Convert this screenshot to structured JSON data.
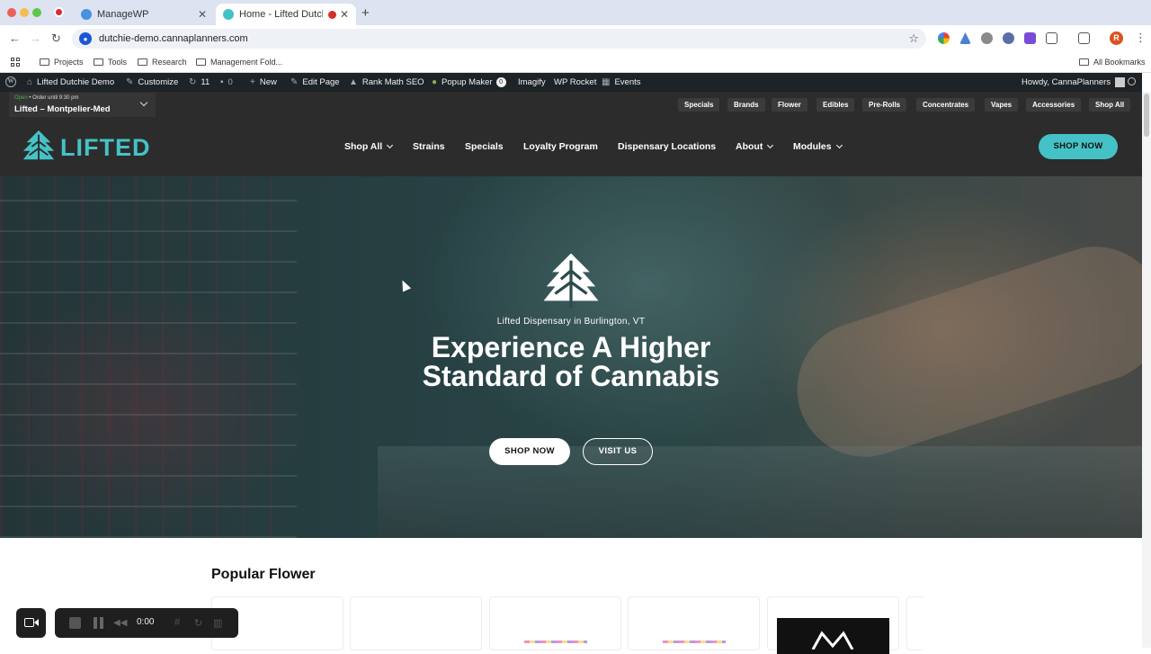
{
  "browser": {
    "tabs": [
      {
        "title": "ManageWP",
        "active": false
      },
      {
        "title": "Home - Lifted Dutchie Demo",
        "active": true
      }
    ],
    "url": "dutchie-demo.cannaplanners.com",
    "avatar_letter": "R",
    "bookmarks": [
      "Projects",
      "Tools",
      "Research",
      "Management Fold..."
    ],
    "all_bookmarks": "All Bookmarks"
  },
  "wp_admin_bar": {
    "site": "Lifted Dutchie Demo",
    "customize": "Customize",
    "updates": "11",
    "comments": "0",
    "new": "New",
    "edit_page": "Edit Page",
    "rank_math": "Rank Math SEO",
    "popup_maker": "Popup Maker",
    "popup_count": "0",
    "imagify": "Imagify",
    "wp_rocket": "WP Rocket",
    "events": "Events",
    "howdy": "Howdy, CannaPlanners"
  },
  "store": {
    "status": "Open",
    "hours": "• Order until 9:30 pm",
    "name": "Lifted – Montpelier-Med"
  },
  "categories": [
    "Specials",
    "Brands",
    "Flower",
    "Edibles",
    "Pre-Rolls",
    "Concentrates",
    "Vapes",
    "Accessories",
    "Shop All"
  ],
  "brand": {
    "name": "LIFTED",
    "accent": "#45c2c6"
  },
  "nav": {
    "items": [
      "Shop All",
      "Strains",
      "Specials",
      "Loyalty Program",
      "Dispensary Locations",
      "About",
      "Modules"
    ],
    "cta": "SHOP NOW"
  },
  "hero": {
    "kicker": "Lifted Dispensary in Burlington, VT",
    "title": "Experience A Higher Standard of Cannabis",
    "btn_shop": "SHOP NOW",
    "btn_visit": "VISIT US"
  },
  "popular": {
    "title": "Popular Flower"
  },
  "recorder": {
    "time": "0:00"
  }
}
